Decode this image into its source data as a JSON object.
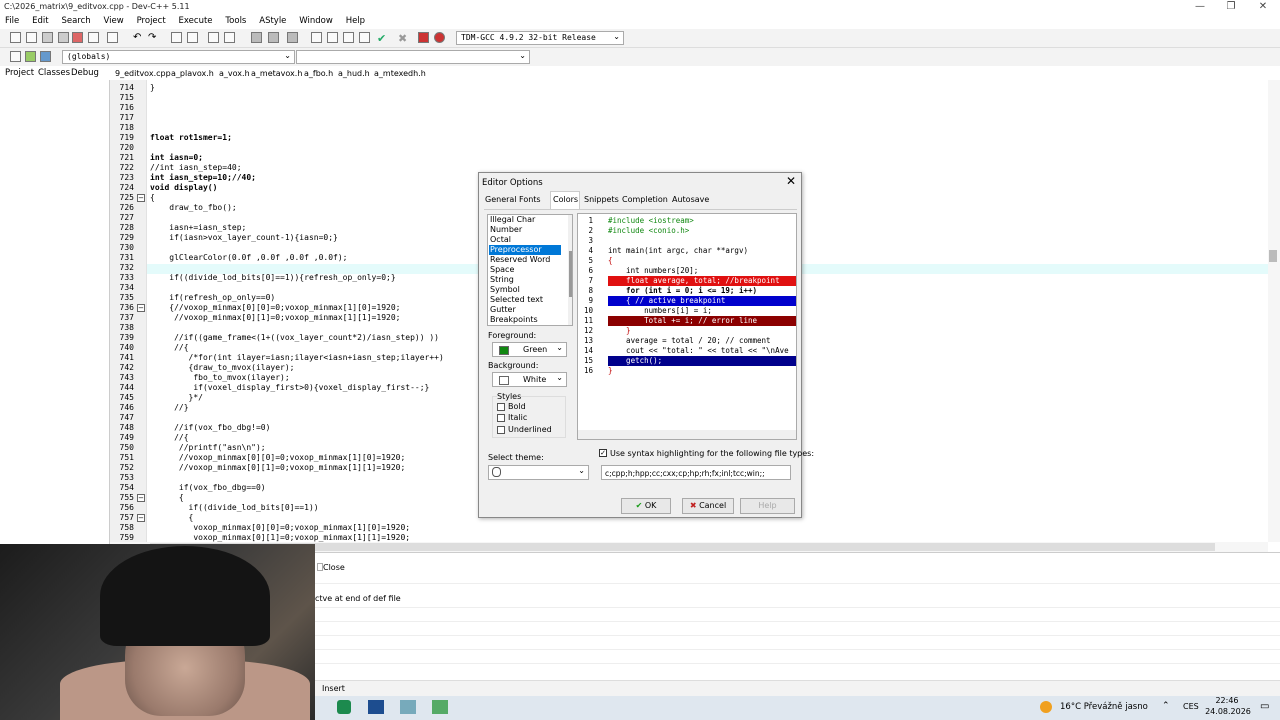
{
  "window": {
    "title": "C:\\2026_matrix\\9_editvox.cpp - Dev-C++ 5.11"
  },
  "menu": [
    "File",
    "Edit",
    "Search",
    "View",
    "Project",
    "Execute",
    "Tools",
    "AStyle",
    "Window",
    "Help"
  ],
  "toolbar": {
    "compiler": "TDM-GCC 4.9.2 32-bit Release",
    "scope": "(globals)"
  },
  "left_tabs": [
    "Project",
    "Classes",
    "Debug"
  ],
  "file_tabs": [
    "9_editvox.cpp",
    "a_plavox.h",
    "a_vox.h",
    "a_metavox.h",
    "a_fbo.h",
    "a_hud.h",
    "a_mtexedh.h"
  ],
  "editor": {
    "lines": [
      {
        "n": "714",
        "t": "}"
      },
      {
        "n": "715",
        "t": ""
      },
      {
        "n": "716",
        "t": ""
      },
      {
        "n": "717",
        "t": ""
      },
      {
        "n": "718",
        "t": ""
      },
      {
        "n": "719",
        "t": "float rot1smer=1;"
      },
      {
        "n": "720",
        "t": ""
      },
      {
        "n": "721",
        "t": "int iasn=0;"
      },
      {
        "n": "722",
        "t": "//int iasn_step=40;"
      },
      {
        "n": "723",
        "t": "int iasn_step=10;//40;"
      },
      {
        "n": "724",
        "t": "void display()"
      },
      {
        "n": "725",
        "t": "{"
      },
      {
        "n": "726",
        "t": "    draw_to_fbo();"
      },
      {
        "n": "727",
        "t": ""
      },
      {
        "n": "728",
        "t": "    iasn+=iasn_step;"
      },
      {
        "n": "729",
        "t": "    if(iasn>vox_layer_count-1){iasn=0;}"
      },
      {
        "n": "730",
        "t": ""
      },
      {
        "n": "731",
        "t": "    glClearColor(0.0f ,0.0f ,0.0f ,0.0f);"
      },
      {
        "n": "732",
        "t": ""
      },
      {
        "n": "733",
        "t": "    if((divide_lod_bits[0]==1)){refresh_op_only=0;}"
      },
      {
        "n": "734",
        "t": ""
      },
      {
        "n": "735",
        "t": "    if(refresh_op_only==0)"
      },
      {
        "n": "736",
        "t": "    {//voxop_minmax[0][0]=0;voxop_minmax[1][0]=1920;"
      },
      {
        "n": "737",
        "t": "     //voxop_minmax[0][1]=0;voxop_minmax[1][1]=1920;"
      },
      {
        "n": "738",
        "t": ""
      },
      {
        "n": "739",
        "t": "     //if((game_frame<(1+((vox_layer_count*2)/iasn_step)) ))"
      },
      {
        "n": "740",
        "t": "     //{"
      },
      {
        "n": "741",
        "t": "        /*for(int ilayer=iasn;ilayer<iasn+iasn_step;ilayer++)"
      },
      {
        "n": "742",
        "t": "        {draw_to_mvox(ilayer);"
      },
      {
        "n": "743",
        "t": "         fbo_to_mvox(ilayer);"
      },
      {
        "n": "744",
        "t": "         if(voxel_display_first>0){voxel_display_first--;}"
      },
      {
        "n": "745",
        "t": "        }*/"
      },
      {
        "n": "746",
        "t": "     //}"
      },
      {
        "n": "747",
        "t": ""
      },
      {
        "n": "748",
        "t": "     //if(vox_fbo_dbg!=0)"
      },
      {
        "n": "749",
        "t": "     //{"
      },
      {
        "n": "750",
        "t": "      //printf(\"asn\\n\");"
      },
      {
        "n": "751",
        "t": "      //voxop_minmax[0][0]=0;voxop_minmax[1][0]=1920;"
      },
      {
        "n": "752",
        "t": "      //voxop_minmax[0][1]=0;voxop_minmax[1][1]=1920;"
      },
      {
        "n": "753",
        "t": ""
      },
      {
        "n": "754",
        "t": "      if(vox_fbo_dbg==0)"
      },
      {
        "n": "755",
        "t": "      {"
      },
      {
        "n": "756",
        "t": "        if((divide_lod_bits[0]==1))"
      },
      {
        "n": "757",
        "t": "        {"
      },
      {
        "n": "758",
        "t": "         voxop_minmax[0][0]=0;voxop_minmax[1][0]=1920;"
      },
      {
        "n": "759",
        "t": "         voxop_minmax[0][1]=0;voxop_minmax[1][1]=1920;"
      }
    ]
  },
  "bottom_panel": {
    "close_label": "Close",
    "message": "ctve at end of def file"
  },
  "status": {
    "mode": "Insert"
  },
  "taskbar": {
    "weather": "16°C  Převážně jasno",
    "lang": "CES",
    "time": "22:46",
    "date": "24.08.2026"
  },
  "dialog": {
    "title": "Editor Options",
    "close": "✕",
    "tabs": [
      "General",
      "Fonts",
      "Colors",
      "Snippets",
      "Completion",
      "Autosave"
    ],
    "active_tab": "Colors",
    "color_items": [
      "Illegal Char",
      "Number",
      "Octal",
      "Preprocessor",
      "Reserved Word",
      "Space",
      "String",
      "Symbol",
      "Selected text",
      "Gutter",
      "Breakpoints"
    ],
    "selected_item": "Preprocessor",
    "foreground_label": "Foreground:",
    "foreground_value": "Green",
    "background_label": "Background:",
    "background_value": "White",
    "styles_label": "Styles",
    "styles": [
      "Bold",
      "Italic",
      "Underlined"
    ],
    "theme_label": "Select theme:",
    "syntax_check_label": "Use syntax highlighting for the following file types:",
    "file_types": "c;cpp;h;hpp;cc;cxx;cp;hp;rh;fx;inl;tcc;win;;",
    "ok": "OK",
    "cancel": "Cancel",
    "help": "Help",
    "preview": [
      {
        "n": "1",
        "t": "#include <iostream>"
      },
      {
        "n": "2",
        "t": "#include <conio.h>"
      },
      {
        "n": "3",
        "t": ""
      },
      {
        "n": "4",
        "t": "int main(int argc, char **argv)"
      },
      {
        "n": "5",
        "t": "{"
      },
      {
        "n": "6",
        "t": "    int numbers[20];"
      },
      {
        "n": "7",
        "t": "    float average, total; //breakpoint"
      },
      {
        "n": "8",
        "t": "    for (int i = 0; i <= 19; i++)"
      },
      {
        "n": "9",
        "t": "    { // active breakpoint"
      },
      {
        "n": "10",
        "t": "        numbers[i] = i;"
      },
      {
        "n": "11",
        "t": "        Total += i; // error line"
      },
      {
        "n": "12",
        "t": "    }"
      },
      {
        "n": "13",
        "t": "    average = total / 20; // comment"
      },
      {
        "n": "14",
        "t": "    cout << \"total: \" << total << \"\\nAve"
      },
      {
        "n": "15",
        "t": "    getch();"
      },
      {
        "n": "16",
        "t": "}"
      }
    ]
  }
}
